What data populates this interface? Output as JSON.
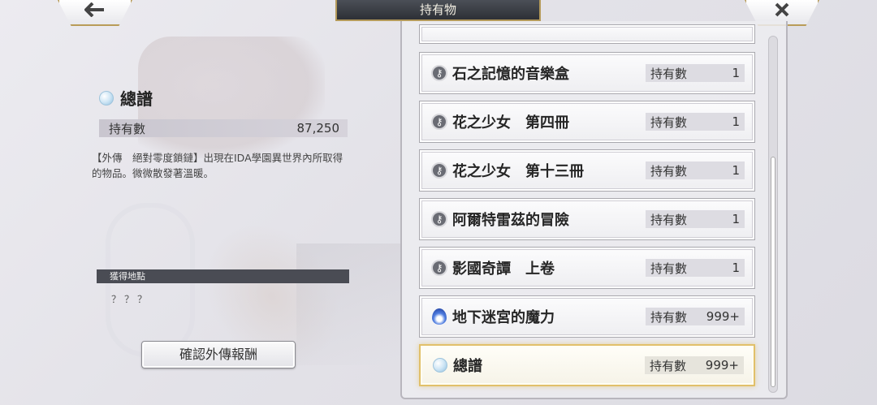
{
  "header": {
    "title": "持有物",
    "back_icon": "back-arrow-icon",
    "close_icon": "close-x-icon"
  },
  "detail": {
    "icon": "gem-icon",
    "name": "總譜",
    "count_label": "持有數",
    "count_value": "87,250",
    "description": "【外傳　絕對零度鎖鏈】出現在IDA學園異世界內所取得的物品。微微散發著溫暖。",
    "source_label": "獲得地點",
    "source_value": "？？？",
    "confirm_button": "確認外傳報酬"
  },
  "list": {
    "count_label": "持有數",
    "items": [
      {
        "name": "石之記憶的音樂盒",
        "count": "1",
        "icon": "key-icon"
      },
      {
        "name": "花之少女　第四冊",
        "count": "1",
        "icon": "key-icon"
      },
      {
        "name": "花之少女　第十三冊",
        "count": "1",
        "icon": "key-icon"
      },
      {
        "name": "阿爾特雷茲的冒險",
        "count": "1",
        "icon": "key-icon"
      },
      {
        "name": "影國奇譚　上卷",
        "count": "1",
        "icon": "key-icon"
      },
      {
        "name": "地下迷宮的魔力",
        "count": "999+",
        "icon": "blue-flame-icon"
      },
      {
        "name": "總譜",
        "count": "999+",
        "icon": "gem-icon",
        "selected": true
      }
    ]
  }
}
